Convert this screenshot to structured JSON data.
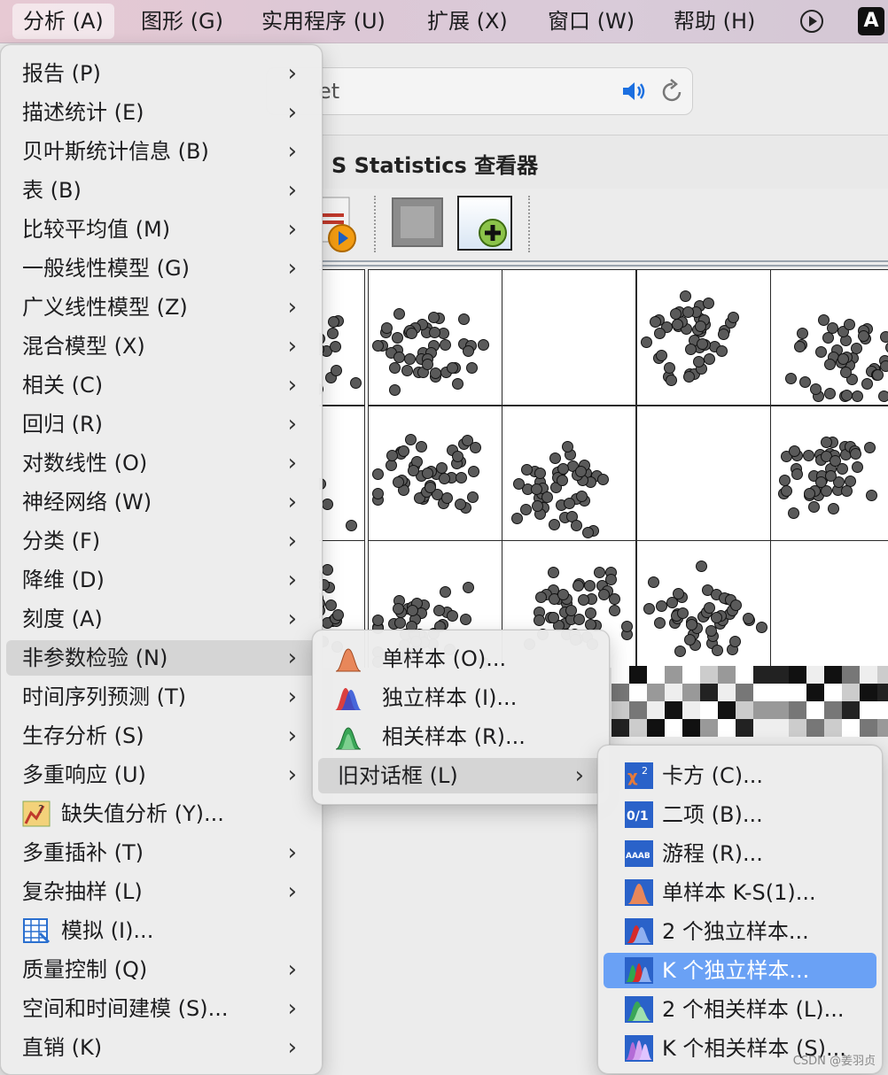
{
  "menubar": {
    "items": [
      "分析 (A)",
      "图形 (G)",
      "实用程序 (U)",
      "扩展 (X)",
      "窗口 (W)",
      "帮助 (H)"
    ],
    "input_badge": "A"
  },
  "background": {
    "search_text": "et",
    "viewer_title": "S Statistics 查看器"
  },
  "menu_analyze": {
    "items": [
      {
        "label": "报告 (P)",
        "submenu": true
      },
      {
        "label": "描述统计 (E)",
        "submenu": true
      },
      {
        "label": "贝叶斯统计信息 (B)",
        "submenu": true
      },
      {
        "label": "表 (B)",
        "submenu": true
      },
      {
        "label": "比较平均值 (M)",
        "submenu": true
      },
      {
        "label": "一般线性模型 (G)",
        "submenu": true
      },
      {
        "label": "广义线性模型 (Z)",
        "submenu": true
      },
      {
        "label": "混合模型 (X)",
        "submenu": true
      },
      {
        "label": "相关 (C)",
        "submenu": true
      },
      {
        "label": "回归 (R)",
        "submenu": true
      },
      {
        "label": "对数线性 (O)",
        "submenu": true
      },
      {
        "label": "神经网络 (W)",
        "submenu": true
      },
      {
        "label": "分类 (F)",
        "submenu": true
      },
      {
        "label": "降维 (D)",
        "submenu": true
      },
      {
        "label": "刻度 (A)",
        "submenu": true
      },
      {
        "label": "非参数检验 (N)",
        "submenu": true,
        "highlighted": true
      },
      {
        "label": "时间序列预测 (T)",
        "submenu": true
      },
      {
        "label": "生存分析 (S)",
        "submenu": true
      },
      {
        "label": "多重响应 (U)",
        "submenu": true
      },
      {
        "label": "缺失值分析 (Y)...",
        "icon": "missing-values-icon"
      },
      {
        "label": "多重插补 (T)",
        "submenu": true
      },
      {
        "label": "复杂抽样 (L)",
        "submenu": true
      },
      {
        "label": "模拟 (I)...",
        "icon": "simulation-icon"
      },
      {
        "label": "质量控制 (Q)",
        "submenu": true
      },
      {
        "label": "空间和时间建模 (S)...",
        "submenu": true
      },
      {
        "label": "直销 (K)",
        "submenu": true
      }
    ]
  },
  "menu_nonparametric": {
    "items": [
      {
        "label": "单样本 (O)...",
        "icon": "one-sample-icon"
      },
      {
        "label": "独立样本 (I)...",
        "icon": "independent-samples-icon"
      },
      {
        "label": "相关样本 (R)...",
        "icon": "related-samples-icon"
      },
      {
        "label": "旧对话框 (L)",
        "submenu": true,
        "highlighted": true
      }
    ]
  },
  "menu_legacy": {
    "items": [
      {
        "label": "卡方 (C)...",
        "icon": "chi-square-icon"
      },
      {
        "label": "二项 (B)...",
        "icon": "binomial-icon"
      },
      {
        "label": "游程 (R)...",
        "icon": "runs-icon"
      },
      {
        "label": "单样本 K-S(1)...",
        "icon": "one-sample-ks-icon"
      },
      {
        "label": "2 个独立样本...",
        "icon": "two-independent-icon"
      },
      {
        "label": "K 个独立样本...",
        "icon": "k-independent-icon",
        "selected": true
      },
      {
        "label": "2 个相关样本 (L)...",
        "icon": "two-related-icon"
      },
      {
        "label": "K 个相关样本 (S)...",
        "icon": "k-related-icon"
      }
    ]
  },
  "watermark": "CSDN @姜羽贞",
  "colors": {
    "selection": "#6aa1f5",
    "hover": "#d5d5d5"
  }
}
